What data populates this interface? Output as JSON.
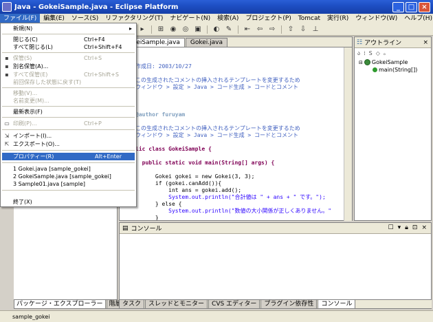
{
  "window": {
    "title": "Java - GokeiSample.java - Eclipse Platform",
    "min": "_",
    "max": "□",
    "close": "×"
  },
  "menubar": {
    "items": [
      "ファイル(F)",
      "編集(E)",
      "ソース(S)",
      "リファクタリング(T)",
      "ナビゲート(N)",
      "検索(A)",
      "プロジェクト(P)",
      "Tomcat",
      "実行(R)",
      "ウィンドウ(W)",
      "ヘルプ(H)"
    ]
  },
  "filemenu": {
    "new": "新規(N)",
    "close": "閉じる(C)",
    "close_acc": "Ctrl+F4",
    "close_all": "すべて閉じる(L)",
    "close_all_acc": "Ctrl+Shift+F4",
    "save": "保管(S)",
    "save_acc": "Ctrl+S",
    "save_as": "別名保管(A)...",
    "save_all": "すべて保管(E)",
    "save_all_acc": "Ctrl+Shift+S",
    "revert": "前回保存した状態に戻す(T)",
    "move": "移動(V)...",
    "rename": "名前変更(M)...",
    "refresh": "最新表示(F)",
    "print": "印刷(P)...",
    "print_acc": "Ctrl+P",
    "import": "インポート(I)...",
    "export": "エクスポート(O)...",
    "properties": "プロパティー(R)",
    "properties_acc": "Alt+Enter",
    "recent1": "1 Gokei.java  [sample_gokei]",
    "recent2": "2 GokeiSample.java  [sample_gokei]",
    "recent3": "3 Sample01.java  [sample]",
    "exit": "終了(X)"
  },
  "editor": {
    "tabs": [
      "GokeiSample.java",
      "Gokei.java"
    ],
    "lines": [
      {
        "t": "作成日: 2003/10/27",
        "c": "c-comment"
      },
      {
        "t": "",
        "c": "c-plain"
      },
      {
        "t": "この生成されたコメントの挿入されるテンプレートを変更するため",
        "c": "c-comment"
      },
      {
        "t": "ウィンドウ > 設定 > Java > コード生成 > コードとコメント",
        "c": "c-comment"
      },
      {
        "t": "",
        "c": "c-plain"
      },
      {
        "t": "",
        "c": "c-plain"
      },
      {
        "t": "",
        "c": "c-plain"
      },
      {
        "t": "@author furuyam",
        "c": "c-ann"
      },
      {
        "t": "",
        "c": "c-plain"
      },
      {
        "t": "この生成されたコメントの挿入されるテンプレートを変更するため",
        "c": "c-comment"
      },
      {
        "t": "ウィンドウ > 設定 > Java > コード生成 > コードとコメント",
        "c": "c-comment"
      },
      {
        "t": "",
        "c": "c-plain"
      },
      {
        "t": "lic class GokeiSample {",
        "c": "c-kw"
      },
      {
        "t": "",
        "c": "c-plain"
      },
      {
        "t": "  public static void main(String[] args) {",
        "c": "c-kw"
      },
      {
        "t": "",
        "c": "c-plain"
      },
      {
        "t": "      Gokei gokei = new Gokei(3, 3);",
        "c": "c-plain"
      },
      {
        "t": "      if (gokei.canAdd()){",
        "c": "c-plain"
      },
      {
        "t": "          int ans = gokei.add();",
        "c": "c-plain"
      },
      {
        "t": "          System.out.println(\"合計値は \" + ans + \" です。\");",
        "c": "c-str"
      },
      {
        "t": "      } else {",
        "c": "c-plain"
      },
      {
        "t": "          System.out.println(\"数値の大小関係が正しくありません。\"",
        "c": "c-str"
      },
      {
        "t": "      }",
        "c": "c-plain"
      },
      {
        "t": "  }",
        "c": "c-plain"
      },
      {
        "t": "",
        "c": "c-plain"
      },
      {
        "t": "}",
        "c": "c-plain"
      }
    ]
  },
  "outline": {
    "title": "アウトライン",
    "class_name": "GokeiSample",
    "method": "main(String[])"
  },
  "console": {
    "title": "コンソール",
    "tabs": [
      "タスク",
      "スレッドとモニター",
      "CVS エディター",
      "プラグイン依存性",
      "コンソール"
    ]
  },
  "pkg": {
    "tabs": [
      "パッケージ・エクスプローラー",
      "階層"
    ]
  },
  "status": {
    "text": "sample_gokei"
  }
}
